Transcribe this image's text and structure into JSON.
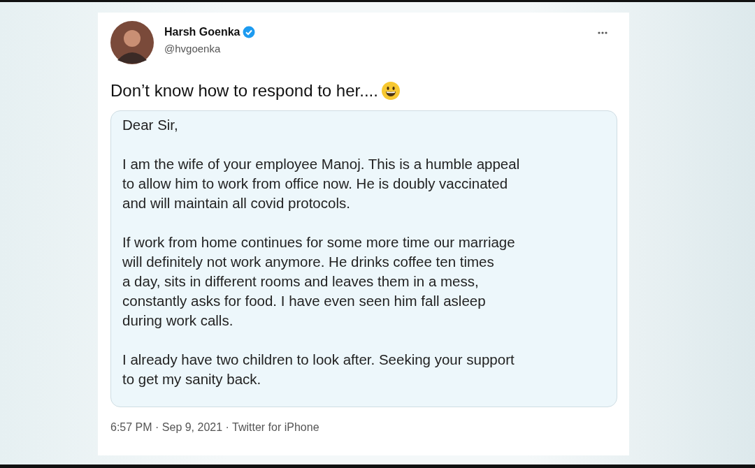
{
  "tweet": {
    "author": {
      "name": "Harsh Goenka",
      "verified": true,
      "handle": "@hvgoenka"
    },
    "text": "Don’t know how to respond to her....",
    "quoted_letter": {
      "salutation": "Dear Sir,",
      "paragraphs": [
        [
          "I am the wife of your employee Manoj. This is a humble appeal",
          "to allow him to work from office now. He is doubly vaccinated",
          "and will maintain all covid protocols."
        ],
        [
          "If work from home continues for some more time our marriage",
          "will definitely not work anymore. He drinks coffee ten times",
          "a day, sits in different rooms and leaves them in a mess,",
          "constantly asks for food. I have even seen him fall asleep",
          "during work calls."
        ],
        [
          "I already have two children to look after. Seeking your support",
          "to get my sanity back."
        ]
      ]
    },
    "meta": "6:57 PM · Sep 9, 2021 · Twitter for iPhone"
  }
}
